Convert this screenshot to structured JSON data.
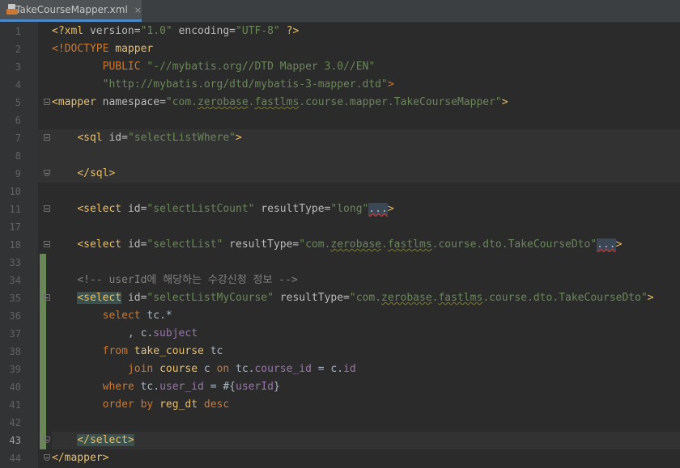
{
  "tab": {
    "title": "TakeCourseMapper.xml",
    "close": "×"
  },
  "lines": [
    {
      "n": "1",
      "t": [
        [
          "tg",
          "<?xml "
        ],
        [
          "an",
          "version="
        ],
        [
          "av",
          "\"1.0\""
        ],
        [
          "an",
          " encoding="
        ],
        [
          "av",
          "\"UTF-8\""
        ],
        [
          "tg",
          " ?>"
        ]
      ]
    },
    {
      "n": "2",
      "t": [
        [
          "kw",
          "<!DOCTYPE "
        ],
        [
          "tg",
          "mapper"
        ]
      ]
    },
    {
      "n": "3",
      "t": [
        [
          "pl",
          "        "
        ],
        [
          "kw",
          "PUBLIC "
        ],
        [
          "av",
          "\"-//mybatis.org//DTD Mapper 3.0//EN\""
        ]
      ]
    },
    {
      "n": "4",
      "t": [
        [
          "pl",
          "        "
        ],
        [
          "av",
          "\"http://mybatis.org/dtd/mybatis-3-mapper.dtd\""
        ],
        [
          "kw",
          ">"
        ]
      ]
    },
    {
      "n": "5",
      "fold": "start",
      "t": [
        [
          "tg",
          "<mapper "
        ],
        [
          "an",
          "namespace="
        ],
        [
          "av",
          "\"com."
        ],
        [
          "av ws",
          "zerobase"
        ],
        [
          "av",
          "."
        ],
        [
          "av ws",
          "fastlms"
        ],
        [
          "av",
          ".course.mapper.TakeCourseMapper\""
        ],
        [
          "tg",
          ">"
        ]
      ]
    },
    {
      "n": "6",
      "t": []
    },
    {
      "n": "7",
      "fold": "start",
      "block": true,
      "t": [
        [
          "pl",
          "    "
        ],
        [
          "tg",
          "<sql "
        ],
        [
          "an",
          "id="
        ],
        [
          "av",
          "\"selectListWhere\""
        ],
        [
          "tg",
          ">"
        ]
      ]
    },
    {
      "n": "8",
      "block": true,
      "t": []
    },
    {
      "n": "9",
      "fold": "end",
      "block": true,
      "t": [
        [
          "pl",
          "    "
        ],
        [
          "tg",
          "</sql>"
        ]
      ]
    },
    {
      "n": "10",
      "t": []
    },
    {
      "n": "11",
      "fold": "start",
      "t": [
        [
          "pl",
          "    "
        ],
        [
          "tg",
          "<select "
        ],
        [
          "an",
          "id="
        ],
        [
          "av",
          "\"selectListCount\""
        ],
        [
          "an",
          " resultType="
        ],
        [
          "av",
          "\"long\""
        ],
        [
          "fb",
          "..."
        ],
        [
          "tg",
          ">"
        ]
      ]
    },
    {
      "n": "17",
      "t": []
    },
    {
      "n": "18",
      "fold": "start",
      "t": [
        [
          "pl",
          "    "
        ],
        [
          "tg",
          "<select "
        ],
        [
          "an",
          "id="
        ],
        [
          "av",
          "\"selectList\""
        ],
        [
          "an",
          " resultType="
        ],
        [
          "av",
          "\"com."
        ],
        [
          "av ws",
          "zerobase"
        ],
        [
          "av",
          "."
        ],
        [
          "av ws",
          "fastlms"
        ],
        [
          "av",
          ".course.dto.TakeCourseDto\""
        ],
        [
          "fb",
          "..."
        ],
        [
          "tg",
          ">"
        ]
      ]
    },
    {
      "n": "33",
      "chg": true,
      "t": []
    },
    {
      "n": "34",
      "chg": true,
      "t": [
        [
          "pl",
          "    "
        ],
        [
          "cm",
          "<!-- userId에 해당하는 수강신청 정보 -->"
        ]
      ]
    },
    {
      "n": "35",
      "chg": true,
      "fold": "start",
      "t": [
        [
          "pl",
          "    "
        ],
        [
          "tg hl",
          "<select"
        ],
        [
          "tg",
          " "
        ],
        [
          "an",
          "id="
        ],
        [
          "av",
          "\"selectListMyCourse\""
        ],
        [
          "an",
          " resultType="
        ],
        [
          "av",
          "\"com."
        ],
        [
          "av ws",
          "zerobase"
        ],
        [
          "av",
          "."
        ],
        [
          "av ws",
          "fastlms"
        ],
        [
          "av",
          ".course.dto.TakeCourseDto\""
        ],
        [
          "tg",
          ">"
        ]
      ]
    },
    {
      "n": "36",
      "chg": true,
      "t": [
        [
          "pl",
          "        "
        ],
        [
          "kw",
          "select "
        ],
        [
          "pl",
          "tc.*"
        ]
      ]
    },
    {
      "n": "37",
      "chg": true,
      "t": [
        [
          "pl",
          "            , c."
        ],
        [
          "fd",
          "subject"
        ]
      ]
    },
    {
      "n": "38",
      "chg": true,
      "t": [
        [
          "pl",
          "        "
        ],
        [
          "kw",
          "from "
        ],
        [
          "tg",
          "take_course "
        ],
        [
          "pl",
          "tc"
        ]
      ]
    },
    {
      "n": "39",
      "chg": true,
      "t": [
        [
          "pl",
          "            "
        ],
        [
          "kw",
          "join "
        ],
        [
          "tg",
          "course "
        ],
        [
          "pl",
          "c "
        ],
        [
          "kw",
          "on "
        ],
        [
          "pl",
          "tc."
        ],
        [
          "fd",
          "course_id"
        ],
        [
          "pl",
          " = c."
        ],
        [
          "fd",
          "id"
        ]
      ]
    },
    {
      "n": "40",
      "chg": true,
      "t": [
        [
          "pl",
          "        "
        ],
        [
          "kw",
          "where "
        ],
        [
          "pl",
          "tc."
        ],
        [
          "fd",
          "user_id"
        ],
        [
          "pl",
          " = #{"
        ],
        [
          "fd",
          "userId"
        ],
        [
          "pl",
          "}"
        ]
      ]
    },
    {
      "n": "41",
      "chg": true,
      "t": [
        [
          "pl",
          "        "
        ],
        [
          "kw",
          "order by "
        ],
        [
          "tg",
          "reg_dt "
        ],
        [
          "kw",
          "desc"
        ]
      ]
    },
    {
      "n": "42",
      "chg": true,
      "t": []
    },
    {
      "n": "43",
      "chg": true,
      "fold": "end",
      "current": true,
      "t": [
        [
          "pl",
          "    "
        ],
        [
          "tg hl",
          "</select>"
        ]
      ]
    },
    {
      "n": "44",
      "fold": "end",
      "t": [
        [
          "tg",
          "</mapper>"
        ]
      ]
    }
  ]
}
